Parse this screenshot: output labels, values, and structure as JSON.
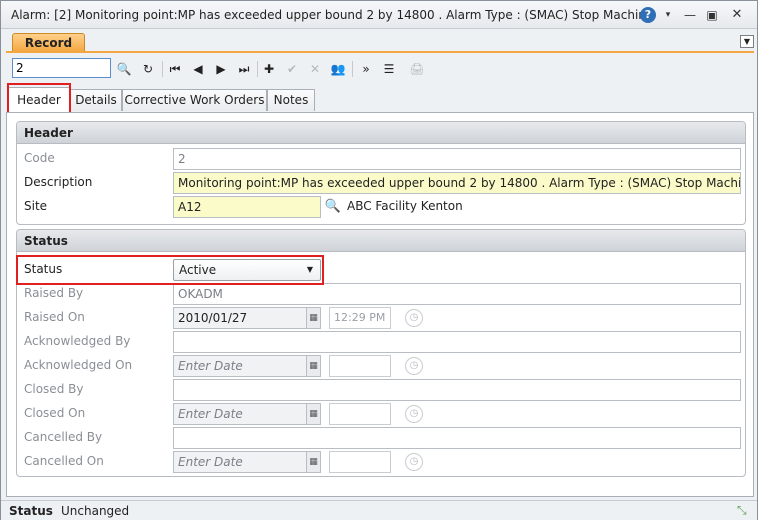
{
  "window": {
    "title": "Alarm: [2] Monitoring point:MP has exceeded upper bound 2 by 14800 . Alarm Type :  (SMAC) Stop Machine",
    "help_icon": "question-mark-icon",
    "help_glyph": "?",
    "caret_glyph": "▾",
    "min_glyph": "—",
    "max_glyph": "▣",
    "close_glyph": "✕"
  },
  "record_tab": {
    "label": "Record",
    "menu_glyph": "▼"
  },
  "toolbar": {
    "record_number": "2",
    "buttons": {
      "search": "🔍",
      "refresh": "↻",
      "first": "⏮",
      "prev": "◀",
      "next": "▶",
      "last": "⏭",
      "add": "✚",
      "confirm": "✔",
      "cancel": "✕",
      "users": "👥",
      "more": "»",
      "list": "☰",
      "print": "🖨"
    }
  },
  "tabs": [
    {
      "label": "Header"
    },
    {
      "label": "Details"
    },
    {
      "label": "Corrective Work Orders"
    },
    {
      "label": "Notes"
    }
  ],
  "header_section": {
    "title": "Header",
    "code_label": "Code",
    "code_value": "2",
    "description_label": "Description",
    "description_value": "Monitoring point:MP has exceeded upper bound 2 by 14800 . Alarm Type :  (SMAC) Stop Machine",
    "site_label": "Site",
    "site_value": "A12",
    "site_name": "ABC Facility Kenton"
  },
  "status_section": {
    "title": "Status",
    "status_label": "Status",
    "status_value": "Active",
    "raised_by_label": "Raised By",
    "raised_by_value": "OKADM",
    "raised_on_label": "Raised On",
    "raised_on_date": "2010/01/27",
    "raised_on_time": "12:29 PM",
    "acknowledged_by_label": "Acknowledged By",
    "acknowledged_on_label": "Acknowledged On",
    "acknowledged_on_placeholder": "Enter Date",
    "closed_by_label": "Closed By",
    "closed_on_label": "Closed On",
    "closed_on_placeholder": "Enter Date",
    "cancelled_by_label": "Cancelled By",
    "cancelled_on_label": "Cancelled On",
    "cancelled_on_placeholder": "Enter Date"
  },
  "statusbar": {
    "label": "Status",
    "value": "Unchanged"
  },
  "colors": {
    "accent": "#f4a640",
    "highlight": "#e02020",
    "yellow_field": "#fbfbc9"
  }
}
